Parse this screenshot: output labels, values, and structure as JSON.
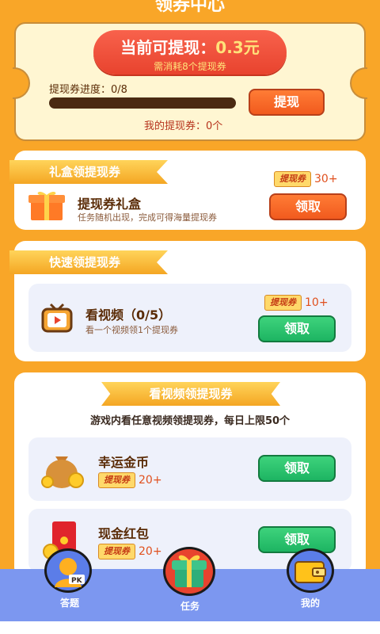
{
  "header": {
    "title": "领券中心"
  },
  "withdraw": {
    "amount_label": "当前可提现：",
    "amount_value": "0.3元",
    "need_text": "需消耗8个提现券",
    "progress_label": "提现券进度：0/8",
    "progress_fraction": 0,
    "button": "提现",
    "my_tickets": "我的提现券：0个"
  },
  "gift_section": {
    "ribbon": "礼盒领提现券",
    "item": {
      "title": "提现券礼盒",
      "subtitle": "任务随机出现，完成可得海量提现券",
      "badge": "提现券",
      "count": "30+",
      "button": "领取",
      "icon": "gift-box-icon"
    }
  },
  "fast_section": {
    "ribbon": "快速领提现券",
    "item": {
      "title": "看视频（0/5）",
      "subtitle": "看一个视频领1个提现券",
      "badge": "提现券",
      "count": "10+",
      "button": "领取",
      "icon": "tv-icon"
    }
  },
  "video_section": {
    "banner": "看视频领提现券",
    "note": "游戏内看任意视频领提现券，每日上限50个",
    "items": [
      {
        "title": "幸运金币",
        "badge": "提现券",
        "count": "20+",
        "button": "领取",
        "icon": "money-bag-icon"
      },
      {
        "title": "现金红包",
        "badge": "提现券",
        "count": "20+",
        "button": "领取",
        "icon": "red-envelope-icon"
      }
    ]
  },
  "nav": {
    "items": [
      {
        "label": "答题",
        "icon": "pk-quiz-icon"
      },
      {
        "label": "任务",
        "icon": "gift-task-icon"
      },
      {
        "label": "我的",
        "icon": "wallet-icon"
      }
    ]
  },
  "colors": {
    "background": "#f9a628",
    "accent_red": "#e8432e",
    "green": "#1db462",
    "nav": "#7c97f0"
  }
}
